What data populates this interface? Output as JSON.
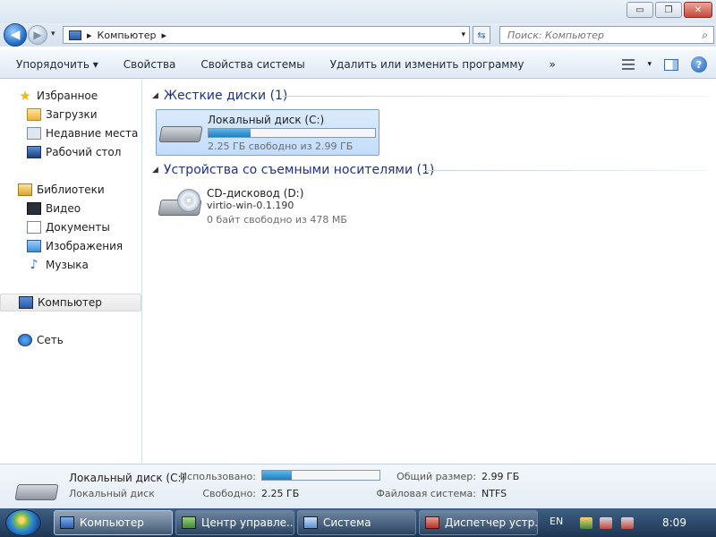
{
  "window": {
    "minimize_glyph": "▭",
    "maximize_glyph": "❐",
    "close_glyph": "✕"
  },
  "address": {
    "back_glyph": "◀",
    "forward_glyph": "▶",
    "path_sep": "▸",
    "path": "Компьютер",
    "path_trail": "▸",
    "dropdown_glyph": "▾",
    "refresh_glyph": "⇆",
    "search_placeholder": "Поиск: Компьютер"
  },
  "toolbar": {
    "organize": "Упорядочить ▾",
    "properties": "Свойства",
    "system_properties": "Свойства системы",
    "uninstall": "Удалить или изменить программу",
    "more": "»"
  },
  "sidebar": {
    "favorites": "Избранное",
    "downloads": "Загрузки",
    "recent": "Недавние места",
    "desktop": "Рабочий стол",
    "libraries": "Библиотеки",
    "video": "Видео",
    "documents": "Документы",
    "pictures": "Изображения",
    "music": "Музыка",
    "computer": "Компьютер",
    "network": "Сеть"
  },
  "main": {
    "hdd_group": "Жесткие диски (1)",
    "removable_group": "Устройства со съемными носителями (1)",
    "drive_c": {
      "name": "Локальный диск (C:)",
      "free_text": "2.25 ГБ свободно из 2.99 ГБ",
      "used_fraction": 0.25
    },
    "drive_d": {
      "name": "CD-дисковод (D:)",
      "label": "virtio-win-0.1.190",
      "free_text": "0 байт свободно из 478 МБ"
    }
  },
  "details": {
    "name": "Локальный диск (C:)",
    "type": "Локальный диск",
    "used_label": "Использовано:",
    "used_fraction": 0.25,
    "free_label": "Свободно:",
    "free_value": "2.25 ГБ",
    "total_label": "Общий размер:",
    "total_value": "2.99 ГБ",
    "fs_label": "Файловая система:",
    "fs_value": "NTFS"
  },
  "taskbar": {
    "tasks": [
      "Компьютер",
      "Центр управле...",
      "Система",
      "Диспетчер устр..."
    ],
    "lang": "EN",
    "clock": "8:09"
  },
  "colors": {
    "accent": "#1f7fbf",
    "group_header": "#1e3287"
  }
}
